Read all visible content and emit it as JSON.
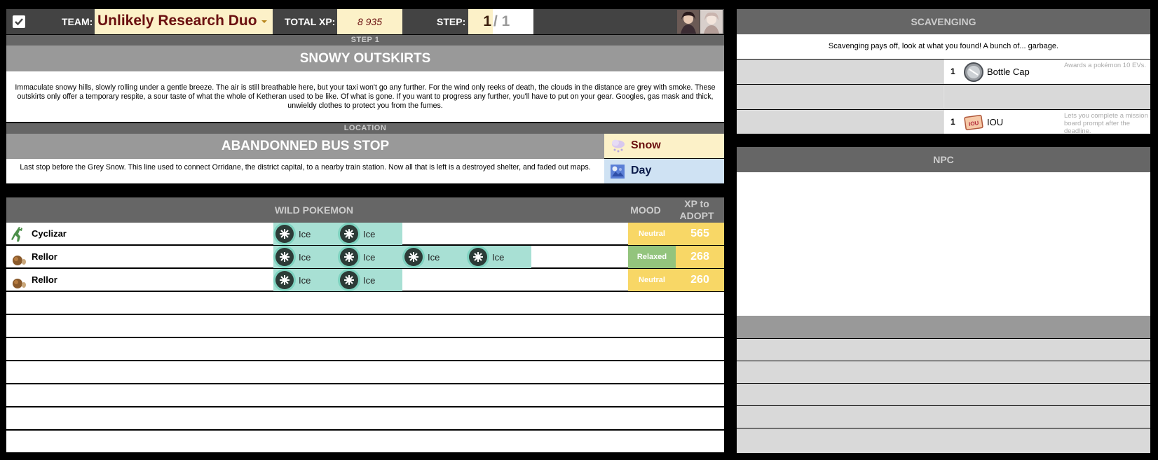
{
  "header": {
    "team_label": "TEAM:",
    "team_value": "Unlikely Research Duo",
    "total_xp_label": "TOTAL XP:",
    "total_xp_value": "8 935",
    "step_label": "STEP:",
    "step_current": "1",
    "step_total": "/ 1"
  },
  "step": {
    "label": "STEP 1",
    "title": "SNOWY OUTSKIRTS",
    "description": "Immaculate snowy hills, slowly rolling under a gentle breeze. The air is still breathable here, but your taxi won't go any further. For the wind only reeks of death, the clouds in the distance are grey with smoke. These outskirts only offer a temporary respite, a sour taste of what the whole of Ketheran used to be like. Of what is gone. If you want to progress any further, you'll have to put on your gear. Googles, gas mask and thick, unwieldy clothes to protect you from the fumes."
  },
  "location": {
    "label": "LOCATION",
    "title": "ABANDONNED BUS STOP",
    "description": "Last stop before the Grey Snow. This line used to connect Orridane, the district capital, to a nearby train station. Now all that is left is a destroyed shelter, and faded out maps.",
    "weather": "Snow",
    "time": "Day"
  },
  "wild": {
    "header": "WILD POKEMON",
    "mood_header": "MOOD",
    "xp_header": "XP to ADOPT",
    "rows": [
      {
        "name": "Cyclizar",
        "types": [
          "Ice",
          "Ice"
        ],
        "mood": "Neutral",
        "xp": "565"
      },
      {
        "name": "Rellor",
        "types": [
          "Ice",
          "Ice",
          "Ice",
          "Ice"
        ],
        "mood": "Relaxed",
        "xp": "268"
      },
      {
        "name": "Rellor",
        "types": [
          "Ice",
          "Ice"
        ],
        "mood": "Neutral",
        "xp": "260"
      }
    ]
  },
  "scavenging": {
    "header": "SCAVENGING",
    "message": "Scavenging pays off, look at what you found! A bunch of... garbage.",
    "items": [
      {
        "qty": "1",
        "name": "Bottle Cap",
        "desc": "Awards a pokémon 10 EVs."
      },
      {
        "qty": "1",
        "name": "IOU",
        "desc": "Lets you complete a mission board prompt after the deadline."
      }
    ]
  },
  "npc": {
    "header": "NPC"
  },
  "colors": {
    "cream": "#fcf1c8",
    "dark_red": "#6a0f0f",
    "ice_type": "#a8e0d4",
    "mood_neutral": "#f8d766",
    "mood_relaxed": "#93c47d",
    "xp_cell": "#f8d766",
    "weather_bg": "#fcf1c8",
    "time_bg": "#cfe2f3"
  }
}
